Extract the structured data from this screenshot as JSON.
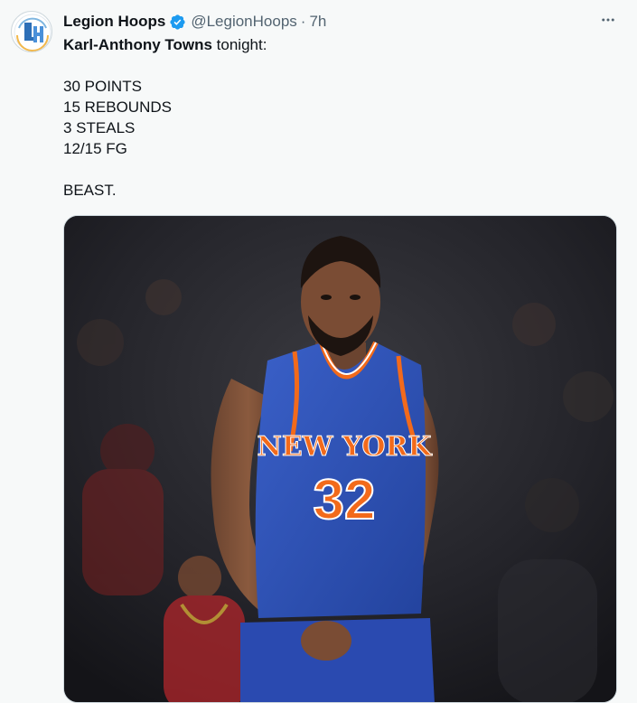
{
  "tweet": {
    "author": {
      "name": "Legion Hoops",
      "handle": "@LegionHoops",
      "verified": true,
      "avatar_icon": "legion-hoops-logo-icon"
    },
    "separator": "·",
    "time": "7h",
    "more_icon": "more-horizontal-icon",
    "text": {
      "player_name": "Karl-Anthony Towns",
      "intro_rest": " tonight:",
      "stats": [
        "30 POINTS",
        "15 REBOUNDS",
        "3 STEALS",
        "12/15 FG"
      ],
      "closing": "BEAST."
    },
    "media": {
      "jersey_team_text": "NEW YORK",
      "jersey_number": "32",
      "colors": {
        "jersey_blue": "#2f52b8",
        "jersey_orange": "#f26a1b",
        "verified_blue": "#1d9bf0"
      }
    }
  }
}
